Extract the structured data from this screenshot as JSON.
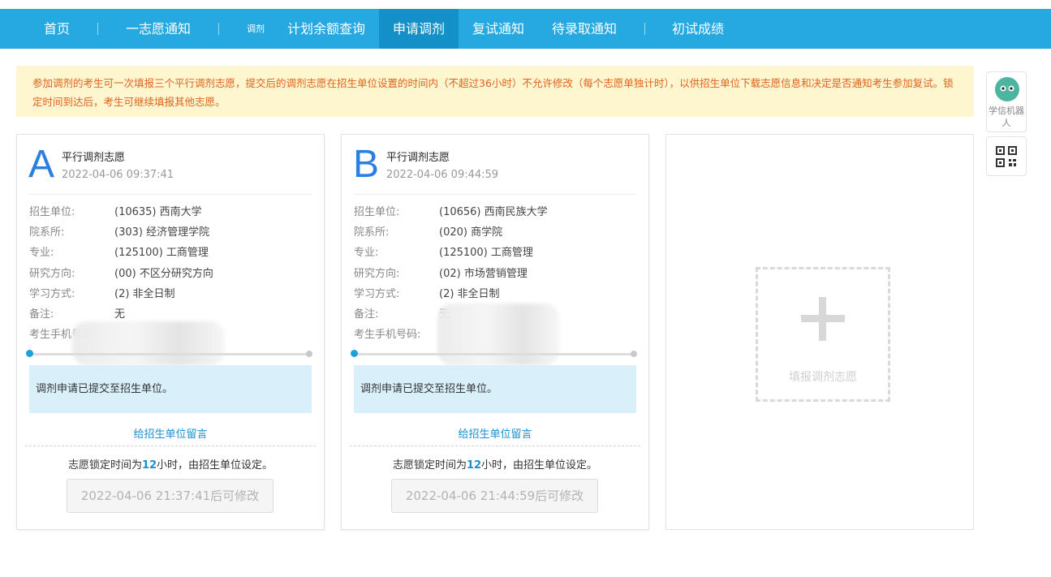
{
  "nav": {
    "items": [
      "首页",
      "一志愿通知",
      "计划余额查询",
      "申请调剂",
      "复试通知",
      "待录取通知",
      "初试成绩"
    ],
    "tag": "调剂",
    "active": "申请调剂"
  },
  "notice": "参加调剂的考生可一次填报三个平行调剂志愿，提交后的调剂志愿在招生单位设置的时间内（不超过36小时）不允许修改（每个志愿单独计时），以供招生单位下载志愿信息和决定是否通知考生参加复试。锁定时间到达后，考生可继续填报其他志愿。",
  "labels": {
    "unit": "招生单位:",
    "dept": "院系所:",
    "major": "专业:",
    "direction": "研究方向:",
    "mode": "学习方式:",
    "remark": "备注:",
    "phone": "考生手机号码:"
  },
  "cards": [
    {
      "letter": "A",
      "title": "平行调剂志愿",
      "time": "2022-04-06 09:37:41",
      "unit": "(10635) 西南大学",
      "dept": "(303) 经济管理学院",
      "major": "(125100) 工商管理",
      "direction": "(00) 不区分研究方向",
      "mode": "(2) 非全日制",
      "remark": "无",
      "status": "调剂申请已提交至招生单位。",
      "message_link": "给招生单位留言",
      "lock_prefix": "志愿锁定时间为",
      "lock_hours": "12",
      "lock_suffix": "小时，由招生单位设定。",
      "modify_button": "2022-04-06 21:37:41后可修改"
    },
    {
      "letter": "B",
      "title": "平行调剂志愿",
      "time": "2022-04-06 09:44:59",
      "unit": "(10656) 西南民族大学",
      "dept": "(020) 商学院",
      "major": "(125100) 工商管理",
      "direction": "(02) 市场营销管理",
      "mode": "(2) 非全日制",
      "remark": "无",
      "status": "调剂申请已提交至招生单位。",
      "message_link": "给招生单位留言",
      "lock_prefix": "志愿锁定时间为",
      "lock_hours": "12",
      "lock_suffix": "小时，由招生单位设定。",
      "modify_button": "2022-04-06 21:44:59后可修改"
    }
  ],
  "add_card": {
    "label": "填报调剂志愿"
  },
  "sidebar": {
    "robot_label": "学信机器人",
    "robot_icon": "robot-icon",
    "qr_icon": "qr-code-icon"
  },
  "colors": {
    "nav": "#26a8e0",
    "nav_active": "#1390c8",
    "notice_bg": "#fdf6cf",
    "notice_text": "#e0621f",
    "accent": "#1a8fd0",
    "letter": "#2b7fe0"
  }
}
